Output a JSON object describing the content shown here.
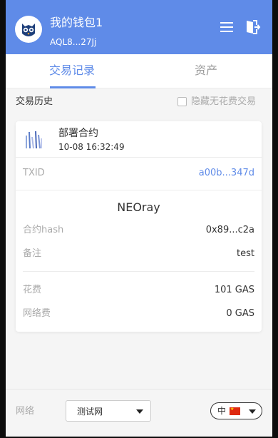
{
  "header": {
    "wallet_name": "我的钱包1",
    "wallet_address": "AQL8...27Jj",
    "accent_color": "#5f8be8",
    "icons": [
      "owl-logo-icon",
      "menu-icon",
      "logout-icon"
    ]
  },
  "tabs": [
    {
      "label": "交易记录",
      "active": true
    },
    {
      "label": "资产",
      "active": false
    }
  ],
  "history": {
    "title": "交易历史",
    "hide_no_fee_label": "隐藏无花费交易",
    "hide_no_fee_checked": false
  },
  "transaction": {
    "type_label": "部署合约",
    "time": "10-08 16:32:49",
    "icon": "contract-deploy-icon",
    "txid_label": "TXID",
    "txid_value": "a00b...347d",
    "contract_name": "NEOray",
    "hash_label": "合约hash",
    "hash_value": "0x89...c2a",
    "remark_label": "备注",
    "remark_value": "test",
    "fee_label": "花费",
    "fee_value": "101 GAS",
    "network_fee_label": "网络费",
    "network_fee_value": "0 GAS"
  },
  "footer": {
    "network_label": "网络",
    "network_selected": "测试网",
    "language_selected": "中",
    "language_flag": "cn-flag-icon"
  }
}
